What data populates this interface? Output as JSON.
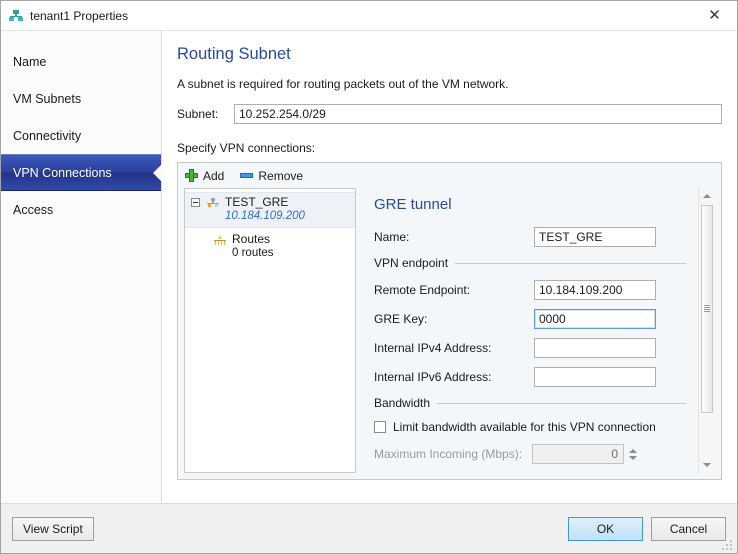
{
  "window": {
    "title": "tenant1 Properties",
    "icon": "network-subnet-icon",
    "close_label": "✕"
  },
  "sidebar": {
    "items": [
      {
        "label": "Name",
        "selected": false
      },
      {
        "label": "VM Subnets",
        "selected": false
      },
      {
        "label": "Connectivity",
        "selected": false
      },
      {
        "label": "VPN Connections",
        "selected": true
      },
      {
        "label": "Access",
        "selected": false
      }
    ]
  },
  "main": {
    "page_title": "Routing Subnet",
    "description": "A subnet is required for routing packets out of the VM network.",
    "subnet_label": "Subnet:",
    "subnet_value": "10.252.254.0/29",
    "specify_label": "Specify VPN connections:"
  },
  "toolbar": {
    "add_label": "Add",
    "remove_label": "Remove"
  },
  "tree": {
    "node_title": "TEST_GRE",
    "node_subtitle": "10.184.109.200",
    "child_title": "Routes",
    "child_subtitle": "0 routes"
  },
  "detail": {
    "title": "GRE tunnel",
    "name_label": "Name:",
    "name_value": "TEST_GRE",
    "endpoint_group": "VPN endpoint",
    "remote_endpoint_label": "Remote Endpoint:",
    "remote_endpoint_value": "10.184.109.200",
    "gre_key_label": "GRE Key:",
    "gre_key_value": "0000",
    "ipv4_label": "Internal IPv4 Address:",
    "ipv4_value": "",
    "ipv6_label": "Internal IPv6 Address:",
    "ipv6_value": "",
    "bandwidth_group": "Bandwidth",
    "limit_checkbox_label": "Limit bandwidth available for this VPN connection",
    "max_incoming_label": "Maximum Incoming (Mbps):",
    "max_incoming_value": "0"
  },
  "footer": {
    "view_script_label": "View Script",
    "ok_label": "OK",
    "cancel_label": "Cancel"
  },
  "colors": {
    "accent_heading": "#2a4b9b",
    "nav_selected": "#2b3f9e",
    "link_blue": "#2a6fd0",
    "add_green": "#4eaf43",
    "remove_blue": "#3d9ae0"
  }
}
